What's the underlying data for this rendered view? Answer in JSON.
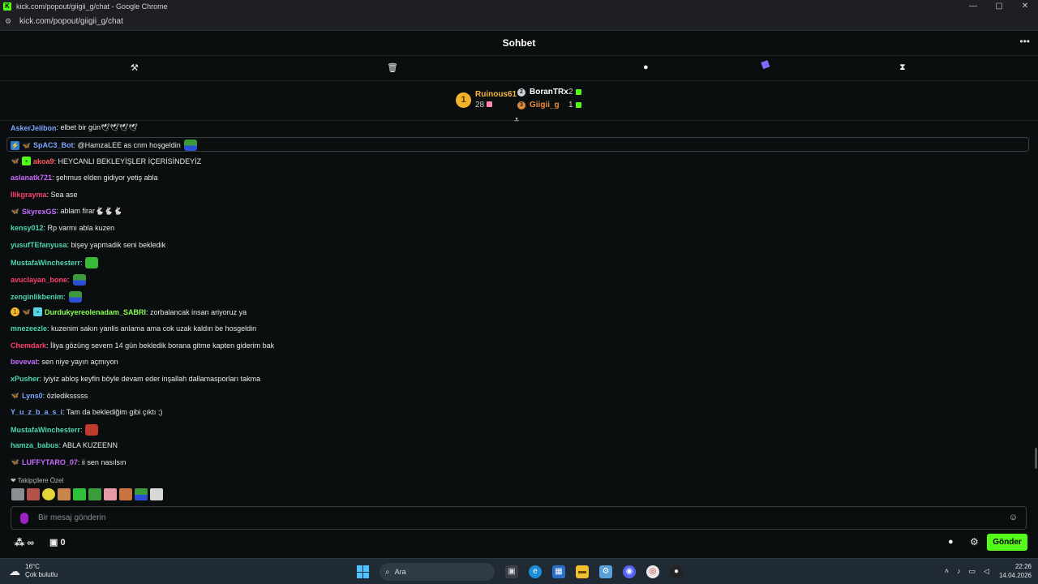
{
  "window": {
    "title": "kick.com/popout/giigii_g/chat - Google Chrome",
    "url": "kick.com/popout/giigii_g/chat",
    "favicon": "K",
    "controls": [
      "—",
      "▢",
      "✕"
    ]
  },
  "header": {
    "title": "Sohbet",
    "more": "•••"
  },
  "toolbar": {
    "hammer": "⚒",
    "trash": "🗑",
    "bubble": "●",
    "hourglass": "⧗"
  },
  "leaderboard": {
    "first": {
      "rank": "1",
      "name": "Ruinous61",
      "count": "28"
    },
    "second": {
      "rank": "2",
      "name": "BoranTRx",
      "count": "2"
    },
    "third": {
      "rank": "3",
      "name": "Giigii_g",
      "count": "1"
    }
  },
  "messages": [
    {
      "user": "AskerJelibon",
      "color": "#7aa7ff",
      "text": ": elbet bir gün🕊🕊🕊🕊"
    },
    {
      "user": "SpAC3_Bot",
      "color": "#7aa7ff",
      "text": ": @HamzaLEE as cnm hoşgeldin",
      "mention": "@HamzaLEE"
    },
    {
      "user": "akoa9",
      "color": "#ff5b5b",
      "text": ": HEYCANLI BEKLEYİŞLER İÇERİSİNDEYİZ"
    },
    {
      "user": "aslanatk721",
      "color": "#c86bff",
      "text": ": şehmus elden gidiyor yetiş abla"
    },
    {
      "user": "Ilikgrayma",
      "color": "#ff3f6c",
      "text": ": Sea ase"
    },
    {
      "user": "SkyrexGS",
      "color": "#c86bff",
      "text": ": ablam firar🐇🐇🐇"
    },
    {
      "user": "kensy012",
      "color": "#4cd6b0",
      "text": ": Rp varmı abla kuzen"
    },
    {
      "user": "yusufTEfanyusa",
      "color": "#4cd6b0",
      "text": ": bişey yapmadik seni bekledik"
    },
    {
      "user": "MustafaWinchesterr",
      "color": "#4cd6b0",
      "text": ":"
    },
    {
      "user": "avuclayan_bone",
      "color": "#ff3f6c",
      "text": ":"
    },
    {
      "user": "zenginlikbenim",
      "color": "#4cd6b0",
      "text": ":"
    },
    {
      "user": "Durdukyereolenadam_SABRI",
      "color": "#88ff50",
      "text": ": zorbalancak insan ariyoruz ya"
    },
    {
      "user": "mnezeezle",
      "color": "#4cd6b0",
      "text": ": kuzenim sakın yanlis anlama ama cok uzak kaldın be hosgeldin"
    },
    {
      "user": "Chemdark",
      "color": "#ff3f6c",
      "text": ": İliya gözüng sevem 14 gün bekledik borana gitme kapten giderim bak"
    },
    {
      "user": "bevevat",
      "color": "#c86bff",
      "text": ": sen niye yayın açmıyon"
    },
    {
      "user": "xPusher",
      "color": "#4cd6b0",
      "text": ": iyiyiz abloş keyfin böyle devam eder inşallah dallamasporları takma"
    },
    {
      "user": "Lyns0",
      "color": "#7aa7ff",
      "text": ": özlediksssss"
    },
    {
      "user": "Y_u_z_b_a_s_i",
      "color": "#7aa7ff",
      "text": ": Tam da beklediğim gibi çıktı ;)"
    },
    {
      "user": "MustafaWinchesterr",
      "color": "#4cd6b0",
      "text": ":"
    },
    {
      "user": "hamza_babus",
      "color": "#4cd6b0",
      "text": ": ABLA KUZEENN"
    },
    {
      "user": "LUFFYTARO_07",
      "color": "#c86bff",
      "text": ": ii sen nasılsın"
    }
  ],
  "followers_label": "❤ Takipçilere Özel",
  "input": {
    "placeholder": "Bir mesaj gönderin"
  },
  "bottom": {
    "left_a": "⁂ ∞",
    "gift_count": "0",
    "send_label": "Gönder"
  },
  "taskbar": {
    "temp": "16°C",
    "weather": "Çok bulutlu",
    "search": "Ara",
    "time": "22:26",
    "date": "14.04.2026"
  },
  "colors": {
    "accent": "#53fc18",
    "background": "#0b0e0f"
  }
}
